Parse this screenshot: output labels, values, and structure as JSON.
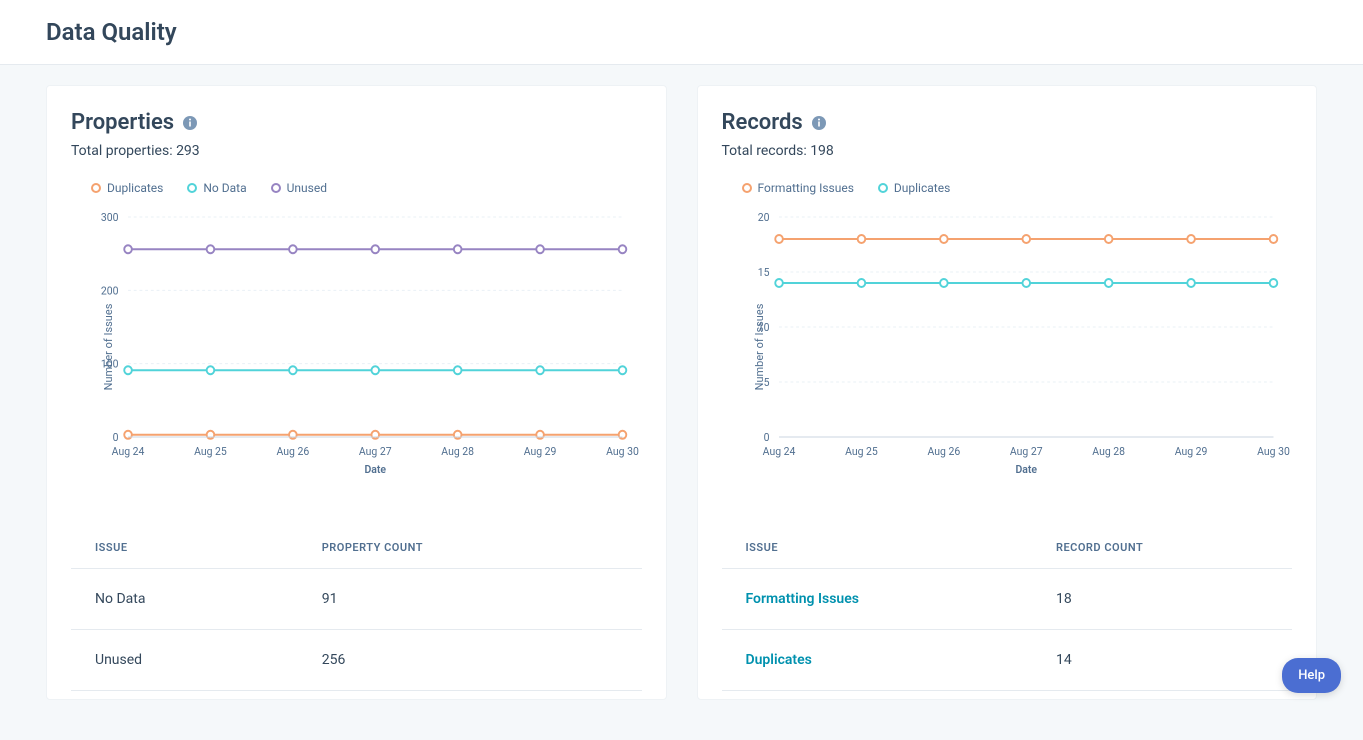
{
  "page_title": "Data Quality",
  "help_label": "Help",
  "properties": {
    "title": "Properties",
    "subtitle_prefix": "Total properties: ",
    "total": 293,
    "legend": [
      {
        "name": "Duplicates",
        "color": "#f5a26f"
      },
      {
        "name": "No Data",
        "color": "#51d3d9"
      },
      {
        "name": "Unused",
        "color": "#9784c2"
      }
    ],
    "table": {
      "col_issue": "ISSUE",
      "col_count": "PROPERTY COUNT",
      "rows": [
        {
          "issue": "No Data",
          "count": 91,
          "link": false
        },
        {
          "issue": "Unused",
          "count": 256,
          "link": false
        }
      ]
    }
  },
  "records": {
    "title": "Records",
    "subtitle_prefix": "Total records: ",
    "total": 198,
    "legend": [
      {
        "name": "Formatting Issues",
        "color": "#f5a26f"
      },
      {
        "name": "Duplicates",
        "color": "#51d3d9"
      }
    ],
    "table": {
      "col_issue": "ISSUE",
      "col_count": "RECORD COUNT",
      "rows": [
        {
          "issue": "Formatting Issues",
          "count": 18,
          "link": true
        },
        {
          "issue": "Duplicates",
          "count": 14,
          "link": true
        }
      ]
    }
  },
  "chart_data": [
    {
      "id": "properties",
      "type": "line",
      "xlabel": "Date",
      "ylabel": "Number of Issues",
      "categories": [
        "Aug 24",
        "Aug 25",
        "Aug 26",
        "Aug 27",
        "Aug 28",
        "Aug 29",
        "Aug 30"
      ],
      "ylim": [
        0,
        300
      ],
      "yticks": [
        0,
        100,
        200,
        300
      ],
      "series": [
        {
          "name": "Duplicates",
          "color": "#f5a26f",
          "values": [
            3,
            3,
            3,
            3,
            3,
            3,
            3
          ]
        },
        {
          "name": "No Data",
          "color": "#51d3d9",
          "values": [
            91,
            91,
            91,
            91,
            91,
            91,
            91
          ]
        },
        {
          "name": "Unused",
          "color": "#9784c2",
          "values": [
            256,
            256,
            256,
            256,
            256,
            256,
            256
          ]
        }
      ]
    },
    {
      "id": "records",
      "type": "line",
      "xlabel": "Date",
      "ylabel": "Number of Issues",
      "categories": [
        "Aug 24",
        "Aug 25",
        "Aug 26",
        "Aug 27",
        "Aug 28",
        "Aug 29",
        "Aug 30"
      ],
      "ylim": [
        0,
        20
      ],
      "yticks": [
        0,
        5,
        10,
        15,
        20
      ],
      "series": [
        {
          "name": "Formatting Issues",
          "color": "#f5a26f",
          "values": [
            18,
            18,
            18,
            18,
            18,
            18,
            18
          ]
        },
        {
          "name": "Duplicates",
          "color": "#51d3d9",
          "values": [
            14,
            14,
            14,
            14,
            14,
            14,
            14
          ]
        }
      ]
    }
  ]
}
